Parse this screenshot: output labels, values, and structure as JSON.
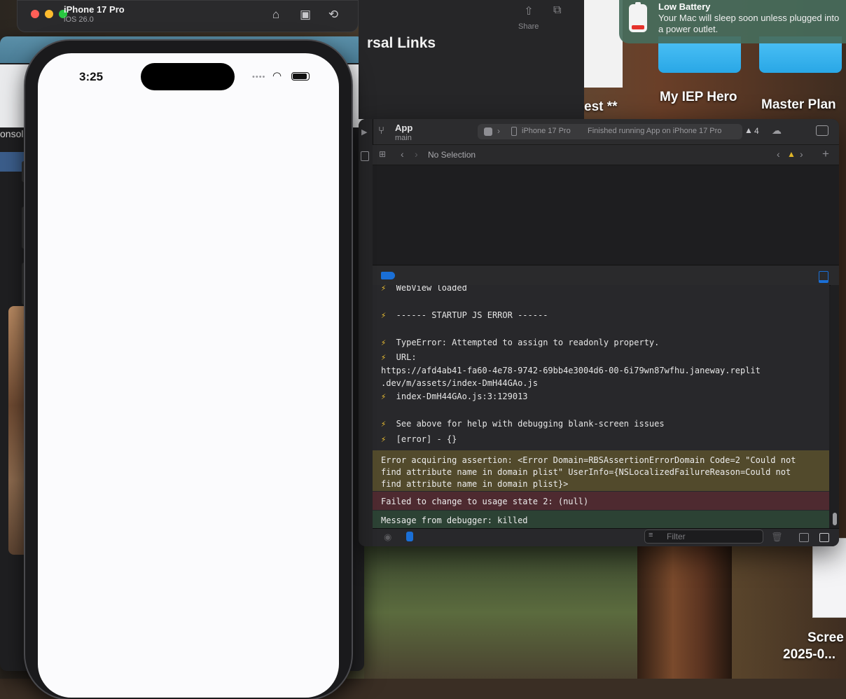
{
  "simulator": {
    "device": "iPhone 17 Pro",
    "os": "iOS 26.0",
    "toolbar_icons": [
      "home-icon",
      "screenshot-icon",
      "rotate-icon"
    ]
  },
  "phone": {
    "time": "3:25",
    "signal_dots": "••••"
  },
  "behind_window": {
    "console_label": "onsole"
  },
  "finder": {
    "share_label": "Share",
    "heading": "rsal Links"
  },
  "desktop": {
    "icons": [
      {
        "label": "est **"
      },
      {
        "label": "My IEP Hero"
      },
      {
        "label": "Master Plan"
      },
      {
        "label": "Scree"
      },
      {
        "label": "2025-0..."
      }
    ]
  },
  "notification": {
    "title": "Low Battery",
    "body": "Your Mac will sleep soon unless plugged into a power outlet."
  },
  "xcode": {
    "scheme": "App",
    "branch": "main",
    "device": "iPhone 17 Pro",
    "status": "Finished running App on iPhone 17 Pro",
    "warning_count": "4",
    "no_selection": "No Selection",
    "filter_placeholder": "Filter",
    "console": {
      "lines": [
        "⚡  WebView loaded",
        "⚡  ------ STARTUP JS ERROR ------",
        "⚡  TypeError: Attempted to assign to readonly property.",
        "⚡  URL:",
        "https://afd4ab41-fa60-4e78-9742-69bb4e3004d6-00-6i79wn87wfhu.janeway.replit",
        ".dev/m/assets/index-DmH44GAo.js",
        "⚡  index-DmH44GAo.js:3:129013",
        "⚡  See above for help with debugging blank-screen issues",
        "⚡  [error] - {}"
      ],
      "warning_block": "Error acquiring assertion: <Error Domain=RBSAssertionErrorDomain Code=2 \"Could not\nfind attribute name in domain plist\" UserInfo={NSLocalizedFailureReason=Could not\nfind attribute name in domain plist}>",
      "error_block": "Failed to change to usage state 2: (null)",
      "info_block": "Message from debugger: killed"
    }
  },
  "colors": {
    "warning_bg": "#524a2c",
    "error_bg": "#4e2a30",
    "info_bg": "#2c4234",
    "accent_blue": "#1a6fd6",
    "warning_yellow": "#f3c532"
  }
}
